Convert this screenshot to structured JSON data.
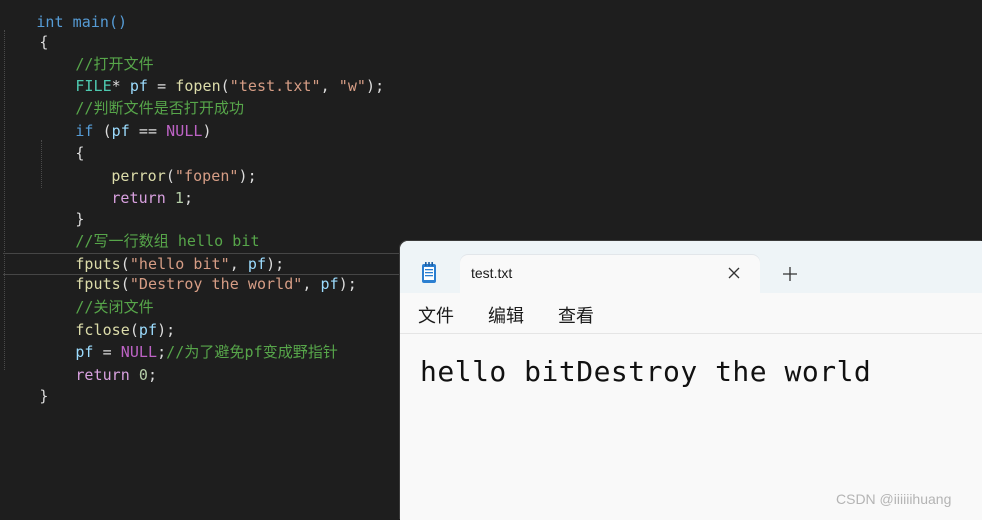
{
  "editor": {
    "code": {
      "l0": "int main()",
      "l1": "{",
      "l2_comment": "//打开文件",
      "l3_type": "FILE",
      "l3_star": "* ",
      "l3_var": "pf",
      "l3_eq": " = ",
      "l3_fn": "fopen",
      "l3_paren": "(",
      "l3_str1": "\"test.txt\"",
      "l3_comma": ", ",
      "l3_str2": "\"w\"",
      "l3_end": ");",
      "l4_comment": "//判断文件是否打开成功",
      "l5_if": "if",
      "l5_open": " (",
      "l5_var": "pf",
      "l5_op": " == ",
      "l5_null": "NULL",
      "l5_close": ")",
      "l6": "{",
      "l7_fn": "perror",
      "l7_open": "(",
      "l7_str": "\"fopen\"",
      "l7_end": ");",
      "l8_ret": "return",
      "l8_num": " 1",
      "l8_end": ";",
      "l9": "}",
      "l10_comment": "//写一行数组 hello bit",
      "l11_fn": "fputs",
      "l11_open": "(",
      "l11_str": "\"hello bit\"",
      "l11_comma": ", ",
      "l11_var": "pf",
      "l11_end": ");",
      "l12_fn": "fputs",
      "l12_open": "(",
      "l12_str": "\"Destroy the world\"",
      "l12_comma": ", ",
      "l12_var": "pf",
      "l12_end": ");",
      "l13_comment": "//关闭文件",
      "l14_fn": "fclose",
      "l14_open": "(",
      "l14_var": "pf",
      "l14_end": ");",
      "l15_var": "pf",
      "l15_eq": " = ",
      "l15_null": "NULL",
      "l15_semi": ";",
      "l15_comment": "//为了避免pf变成野指针",
      "l16_ret": "return",
      "l16_num": " 0",
      "l16_end": ";",
      "l17": "}"
    }
  },
  "notepad": {
    "icon": "notepad-icon",
    "tab_title": "test.txt",
    "close_icon": "close-icon",
    "new_tab_icon": "plus-icon",
    "menu": {
      "file": "文件",
      "edit": "编辑",
      "view": "查看"
    },
    "content": "hello bitDestroy the world"
  },
  "watermark": "CSDN @iiiiiihuang",
  "colors": {
    "editor_bg": "#1e1e1e",
    "notepad_bg": "#f9f9f9",
    "titlebar_bg": "#eef4f7",
    "comment": "#57a64a",
    "string": "#d69d85",
    "keyword": "#569cd6"
  }
}
